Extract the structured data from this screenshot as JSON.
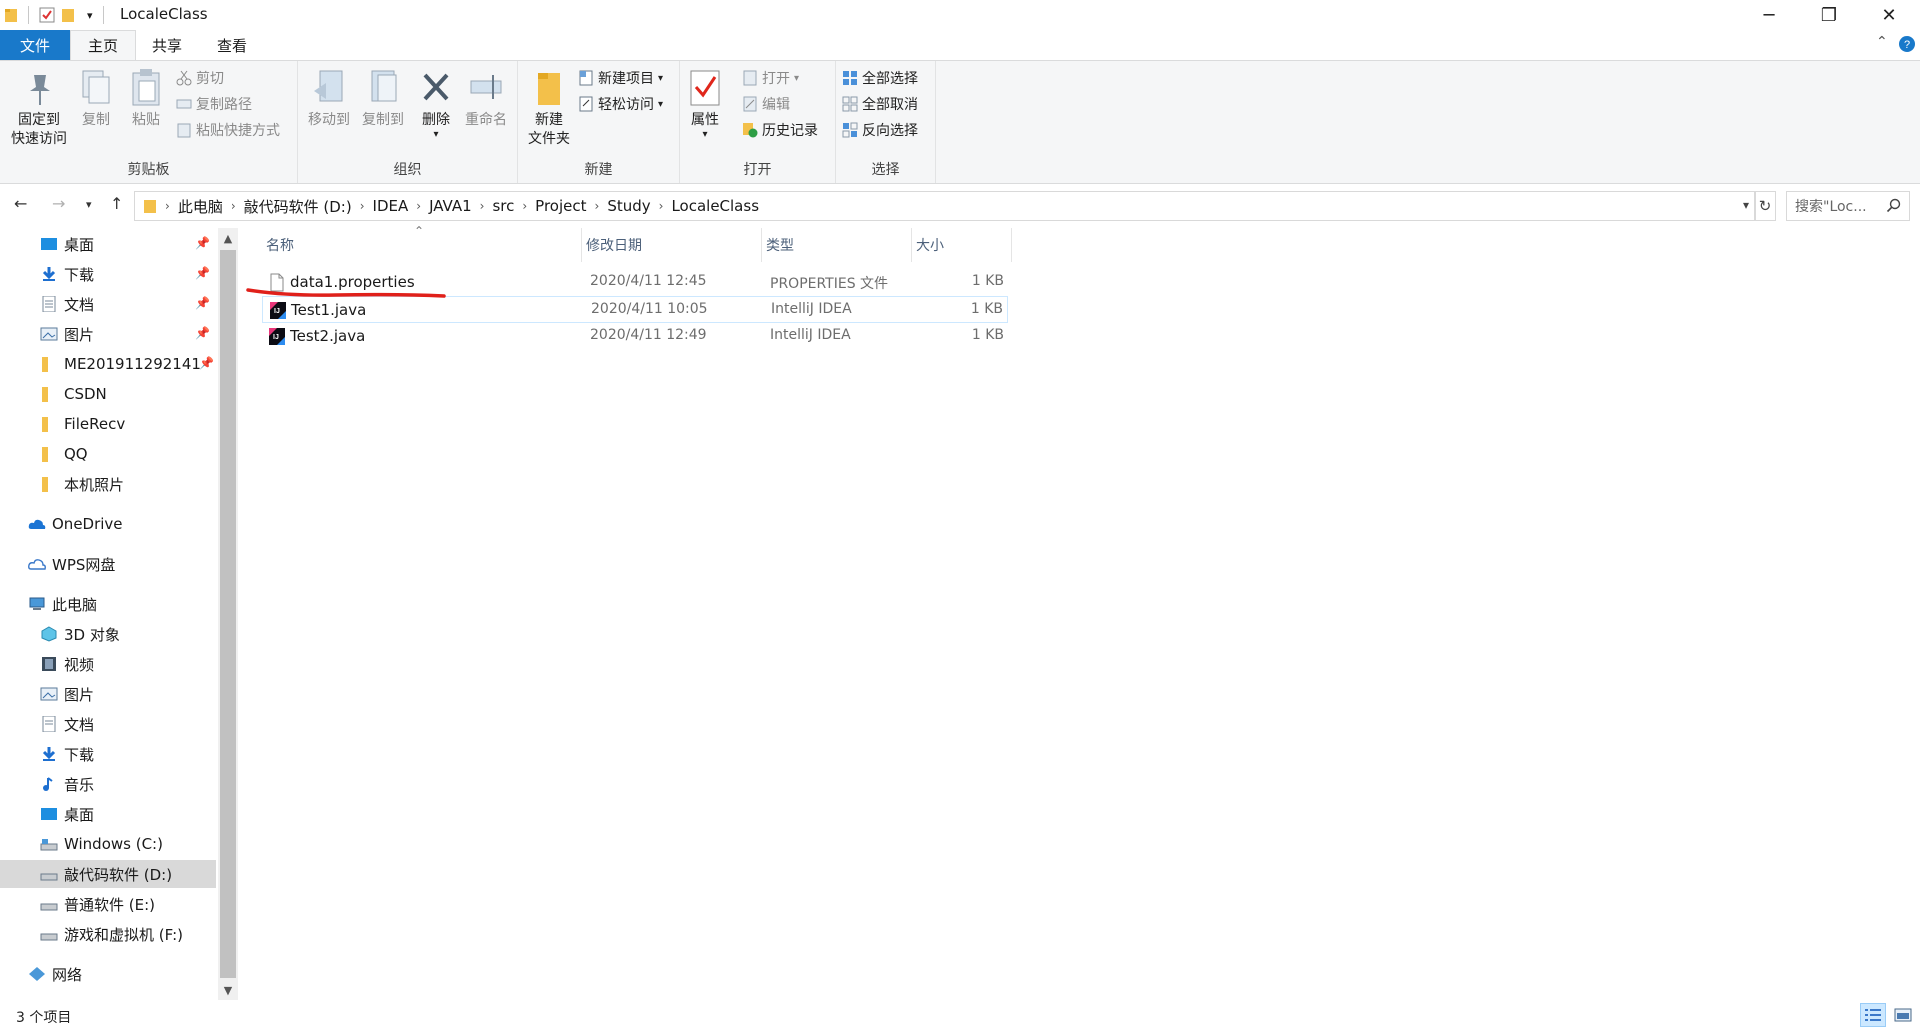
{
  "window": {
    "title": "LocaleClass",
    "controls": {
      "minimize": "─",
      "maximize": "❐",
      "close": "✕"
    }
  },
  "ribbon_tabs": {
    "file": "文件",
    "home": "主页",
    "share": "共享",
    "view": "查看"
  },
  "ribbon": {
    "clipboard": {
      "label": "剪贴板",
      "pin_line1": "固定到",
      "pin_line2": "快速访问",
      "copy": "复制",
      "paste": "粘贴",
      "cut": "剪切",
      "copy_path": "复制路径",
      "paste_shortcut": "粘贴快捷方式"
    },
    "organize": {
      "label": "组织",
      "move_to": "移动到",
      "copy_to": "复制到",
      "delete": "删除",
      "rename": "重命名"
    },
    "new": {
      "label": "新建",
      "new_folder_line1": "新建",
      "new_folder_line2": "文件夹",
      "new_item": "新建项目",
      "easy_access": "轻松访问"
    },
    "open": {
      "label": "打开",
      "properties": "属性",
      "open": "打开",
      "edit": "编辑",
      "history": "历史记录"
    },
    "select": {
      "label": "选择",
      "select_all": "全部选择",
      "select_none": "全部取消",
      "invert": "反向选择"
    }
  },
  "address": {
    "crumbs": [
      "此电脑",
      "敲代码软件 (D:)",
      "IDEA",
      "JAVA1",
      "src",
      "Project",
      "Study",
      "LocaleClass"
    ],
    "search_placeholder": "搜索\"Loc..."
  },
  "nav_pane": {
    "quick": [
      {
        "label": "桌面",
        "icon": "desktop-icon",
        "pinned": true
      },
      {
        "label": "下载",
        "icon": "download-icon",
        "pinned": true
      },
      {
        "label": "文档",
        "icon": "document-icon",
        "pinned": true
      },
      {
        "label": "图片",
        "icon": "picture-icon",
        "pinned": true
      },
      {
        "label": "ME201911292141",
        "icon": "folder-icon",
        "pinned": true
      },
      {
        "label": "CSDN",
        "icon": "folder-icon",
        "pinned": false
      },
      {
        "label": "FileRecv",
        "icon": "folder-icon",
        "pinned": false
      },
      {
        "label": "QQ",
        "icon": "folder-icon",
        "pinned": false
      },
      {
        "label": "本机照片",
        "icon": "folder-icon",
        "pinned": false
      }
    ],
    "onedrive": "OneDrive",
    "wps": "WPS网盘",
    "this_pc": "此电脑",
    "pc_items": [
      {
        "label": "3D 对象",
        "icon": "3d-objects-icon"
      },
      {
        "label": "视频",
        "icon": "video-icon"
      },
      {
        "label": "图片",
        "icon": "picture-icon"
      },
      {
        "label": "文档",
        "icon": "document-icon"
      },
      {
        "label": "下载",
        "icon": "download-icon"
      },
      {
        "label": "音乐",
        "icon": "music-icon"
      },
      {
        "label": "桌面",
        "icon": "desktop-icon"
      },
      {
        "label": "Windows (C:)",
        "icon": "drive-icon"
      },
      {
        "label": "敲代码软件 (D:)",
        "icon": "drive-icon",
        "selected": true
      },
      {
        "label": "普通软件 (E:)",
        "icon": "drive-icon"
      },
      {
        "label": "游戏和虚拟机 (F:)",
        "icon": "drive-icon"
      }
    ],
    "network": "网络"
  },
  "columns": {
    "name": "名称",
    "date": "修改日期",
    "type": "类型",
    "size": "大小"
  },
  "files": [
    {
      "name": "data1.properties",
      "date": "2020/4/11 12:45",
      "type": "PROPERTIES 文件",
      "size": "1 KB",
      "icon": "properties-file-icon"
    },
    {
      "name": "Test1.java",
      "date": "2020/4/11 10:05",
      "type": "IntelliJ IDEA",
      "size": "1 KB",
      "icon": "intellij-file-icon"
    },
    {
      "name": "Test2.java",
      "date": "2020/4/11 12:49",
      "type": "IntelliJ IDEA",
      "size": "1 KB",
      "icon": "intellij-file-icon"
    }
  ],
  "status": {
    "count": "3 个项目"
  },
  "colors": {
    "accent": "#1979ca",
    "annotation": "#e0201a",
    "selection": "#cce8ff"
  }
}
